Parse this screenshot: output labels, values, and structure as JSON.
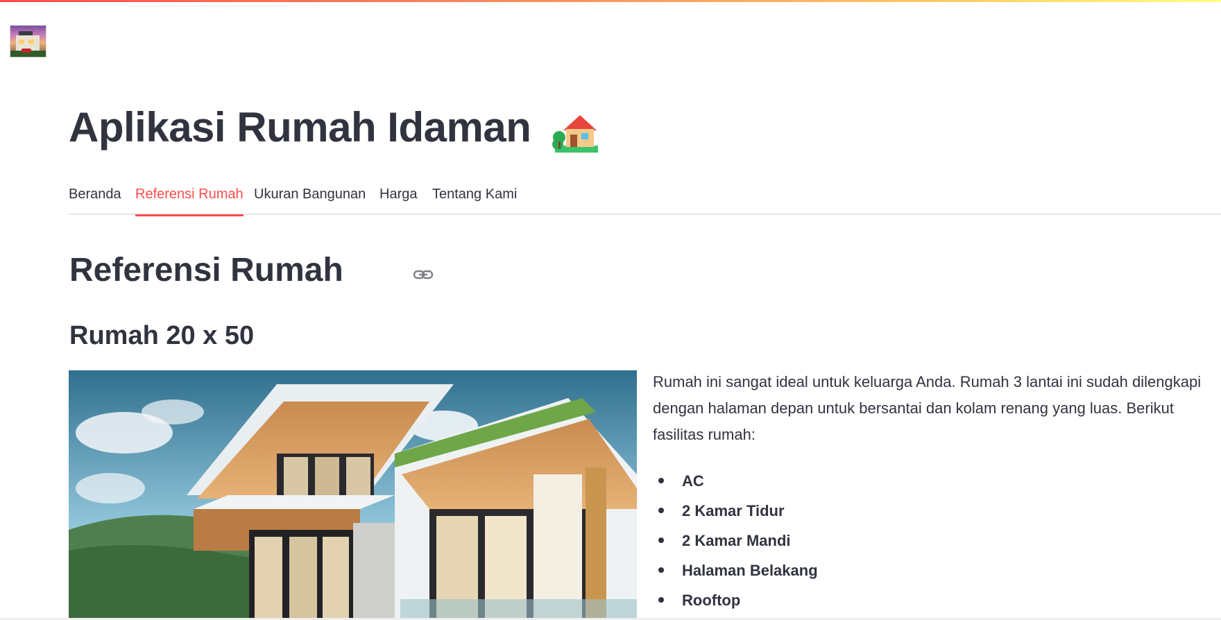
{
  "app": {
    "title": "Aplikasi Rumah Idaman",
    "title_emoji": "house-with-garden-emoji"
  },
  "logo": {
    "alt": "house-photo-logo"
  },
  "tabs": [
    {
      "label": "Beranda",
      "active": false
    },
    {
      "label": "Referensi Rumah",
      "active": true
    },
    {
      "label": "Ukuran Bangunan",
      "active": false
    },
    {
      "label": "Harga",
      "active": false
    },
    {
      "label": "Tentang Kami",
      "active": false
    }
  ],
  "section": {
    "heading": "Referensi Rumah",
    "anchor_icon": "link-icon"
  },
  "listing": {
    "title": "Rumah 20 x 50",
    "description": "Rumah ini sangat ideal untuk keluarga Anda. Rumah 3 lantai ini sudah dilengkapi dengan halaman depan untuk bersantai dan kolam renang yang luas. Berikut fasilitas rumah:",
    "features": [
      "AC",
      "2 Kamar Tidur",
      "2 Kamar Mandi",
      "Halaman Belakang",
      "Rooftop"
    ]
  },
  "colors": {
    "accent": "#ff4b4b",
    "text": "#31333f",
    "divider": "#e6e6ea"
  }
}
